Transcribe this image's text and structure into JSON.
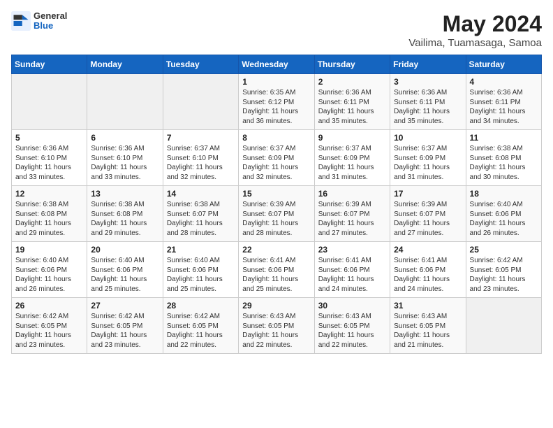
{
  "header": {
    "logo_line1": "General",
    "logo_line2": "Blue",
    "title": "May 2024",
    "subtitle": "Vailima, Tuamasaga, Samoa"
  },
  "weekdays": [
    "Sunday",
    "Monday",
    "Tuesday",
    "Wednesday",
    "Thursday",
    "Friday",
    "Saturday"
  ],
  "weeks": [
    [
      {
        "num": "",
        "info": "",
        "empty": true
      },
      {
        "num": "",
        "info": "",
        "empty": true
      },
      {
        "num": "",
        "info": "",
        "empty": true
      },
      {
        "num": "1",
        "info": "Sunrise: 6:35 AM\nSunset: 6:12 PM\nDaylight: 11 hours\nand 36 minutes.",
        "empty": false
      },
      {
        "num": "2",
        "info": "Sunrise: 6:36 AM\nSunset: 6:11 PM\nDaylight: 11 hours\nand 35 minutes.",
        "empty": false
      },
      {
        "num": "3",
        "info": "Sunrise: 6:36 AM\nSunset: 6:11 PM\nDaylight: 11 hours\nand 35 minutes.",
        "empty": false
      },
      {
        "num": "4",
        "info": "Sunrise: 6:36 AM\nSunset: 6:11 PM\nDaylight: 11 hours\nand 34 minutes.",
        "empty": false
      }
    ],
    [
      {
        "num": "5",
        "info": "Sunrise: 6:36 AM\nSunset: 6:10 PM\nDaylight: 11 hours\nand 33 minutes.",
        "empty": false
      },
      {
        "num": "6",
        "info": "Sunrise: 6:36 AM\nSunset: 6:10 PM\nDaylight: 11 hours\nand 33 minutes.",
        "empty": false
      },
      {
        "num": "7",
        "info": "Sunrise: 6:37 AM\nSunset: 6:10 PM\nDaylight: 11 hours\nand 32 minutes.",
        "empty": false
      },
      {
        "num": "8",
        "info": "Sunrise: 6:37 AM\nSunset: 6:09 PM\nDaylight: 11 hours\nand 32 minutes.",
        "empty": false
      },
      {
        "num": "9",
        "info": "Sunrise: 6:37 AM\nSunset: 6:09 PM\nDaylight: 11 hours\nand 31 minutes.",
        "empty": false
      },
      {
        "num": "10",
        "info": "Sunrise: 6:37 AM\nSunset: 6:09 PM\nDaylight: 11 hours\nand 31 minutes.",
        "empty": false
      },
      {
        "num": "11",
        "info": "Sunrise: 6:38 AM\nSunset: 6:08 PM\nDaylight: 11 hours\nand 30 minutes.",
        "empty": false
      }
    ],
    [
      {
        "num": "12",
        "info": "Sunrise: 6:38 AM\nSunset: 6:08 PM\nDaylight: 11 hours\nand 29 minutes.",
        "empty": false
      },
      {
        "num": "13",
        "info": "Sunrise: 6:38 AM\nSunset: 6:08 PM\nDaylight: 11 hours\nand 29 minutes.",
        "empty": false
      },
      {
        "num": "14",
        "info": "Sunrise: 6:38 AM\nSunset: 6:07 PM\nDaylight: 11 hours\nand 28 minutes.",
        "empty": false
      },
      {
        "num": "15",
        "info": "Sunrise: 6:39 AM\nSunset: 6:07 PM\nDaylight: 11 hours\nand 28 minutes.",
        "empty": false
      },
      {
        "num": "16",
        "info": "Sunrise: 6:39 AM\nSunset: 6:07 PM\nDaylight: 11 hours\nand 27 minutes.",
        "empty": false
      },
      {
        "num": "17",
        "info": "Sunrise: 6:39 AM\nSunset: 6:07 PM\nDaylight: 11 hours\nand 27 minutes.",
        "empty": false
      },
      {
        "num": "18",
        "info": "Sunrise: 6:40 AM\nSunset: 6:06 PM\nDaylight: 11 hours\nand 26 minutes.",
        "empty": false
      }
    ],
    [
      {
        "num": "19",
        "info": "Sunrise: 6:40 AM\nSunset: 6:06 PM\nDaylight: 11 hours\nand 26 minutes.",
        "empty": false
      },
      {
        "num": "20",
        "info": "Sunrise: 6:40 AM\nSunset: 6:06 PM\nDaylight: 11 hours\nand 25 minutes.",
        "empty": false
      },
      {
        "num": "21",
        "info": "Sunrise: 6:40 AM\nSunset: 6:06 PM\nDaylight: 11 hours\nand 25 minutes.",
        "empty": false
      },
      {
        "num": "22",
        "info": "Sunrise: 6:41 AM\nSunset: 6:06 PM\nDaylight: 11 hours\nand 25 minutes.",
        "empty": false
      },
      {
        "num": "23",
        "info": "Sunrise: 6:41 AM\nSunset: 6:06 PM\nDaylight: 11 hours\nand 24 minutes.",
        "empty": false
      },
      {
        "num": "24",
        "info": "Sunrise: 6:41 AM\nSunset: 6:06 PM\nDaylight: 11 hours\nand 24 minutes.",
        "empty": false
      },
      {
        "num": "25",
        "info": "Sunrise: 6:42 AM\nSunset: 6:05 PM\nDaylight: 11 hours\nand 23 minutes.",
        "empty": false
      }
    ],
    [
      {
        "num": "26",
        "info": "Sunrise: 6:42 AM\nSunset: 6:05 PM\nDaylight: 11 hours\nand 23 minutes.",
        "empty": false
      },
      {
        "num": "27",
        "info": "Sunrise: 6:42 AM\nSunset: 6:05 PM\nDaylight: 11 hours\nand 23 minutes.",
        "empty": false
      },
      {
        "num": "28",
        "info": "Sunrise: 6:42 AM\nSunset: 6:05 PM\nDaylight: 11 hours\nand 22 minutes.",
        "empty": false
      },
      {
        "num": "29",
        "info": "Sunrise: 6:43 AM\nSunset: 6:05 PM\nDaylight: 11 hours\nand 22 minutes.",
        "empty": false
      },
      {
        "num": "30",
        "info": "Sunrise: 6:43 AM\nSunset: 6:05 PM\nDaylight: 11 hours\nand 22 minutes.",
        "empty": false
      },
      {
        "num": "31",
        "info": "Sunrise: 6:43 AM\nSunset: 6:05 PM\nDaylight: 11 hours\nand 21 minutes.",
        "empty": false
      },
      {
        "num": "",
        "info": "",
        "empty": true
      }
    ]
  ]
}
